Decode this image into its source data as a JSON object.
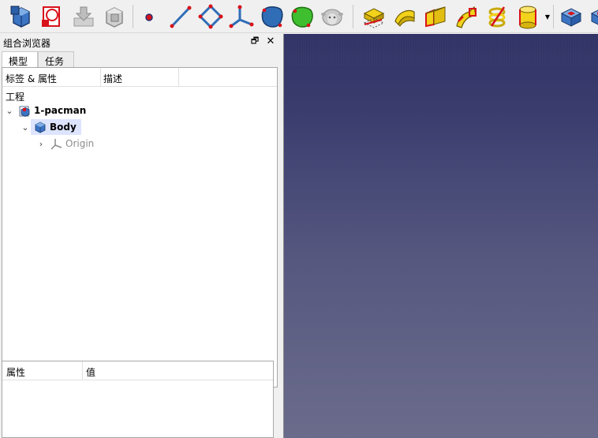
{
  "toolbar": {
    "icons": [
      "part-body-icon",
      "sketch-icon",
      "import-icon",
      "clone-icon",
      "point-icon",
      "line-icon",
      "polygon-icon",
      "coordinate-system-icon",
      "shape-binder-icon",
      "subshape-binder-icon",
      "clone-sheep-icon",
      "pad-icon",
      "revolution-icon",
      "additive-loft-icon",
      "additive-pipe-icon",
      "additive-helix-icon",
      "additive-cylinder-icon",
      "pocket-icon",
      "hole-icon"
    ]
  },
  "combo_view": {
    "title": "组合浏览器",
    "float_symbol": "🗗",
    "close_symbol": "✕",
    "tabs": [
      {
        "label": "模型",
        "active": true
      },
      {
        "label": "任务",
        "active": false
      }
    ]
  },
  "tree": {
    "header_label": "标签 & 属性",
    "header_desc": "描述",
    "root_label": "工程",
    "items": [
      {
        "label": "1-pacman",
        "expanded": true
      },
      {
        "label": "Body",
        "expanded": true,
        "selected": true
      },
      {
        "label": "Origin",
        "expanded": false
      }
    ]
  },
  "property_view": {
    "header_property": "属性",
    "header_value": "值"
  },
  "colors": {
    "selection": "#dde4ff",
    "viewport_top": "#313366",
    "viewport_bottom": "#6b6c8c",
    "accent_yellow": "#f2d21b",
    "accent_red": "#d8121a",
    "accent_blue": "#2f6db7"
  }
}
